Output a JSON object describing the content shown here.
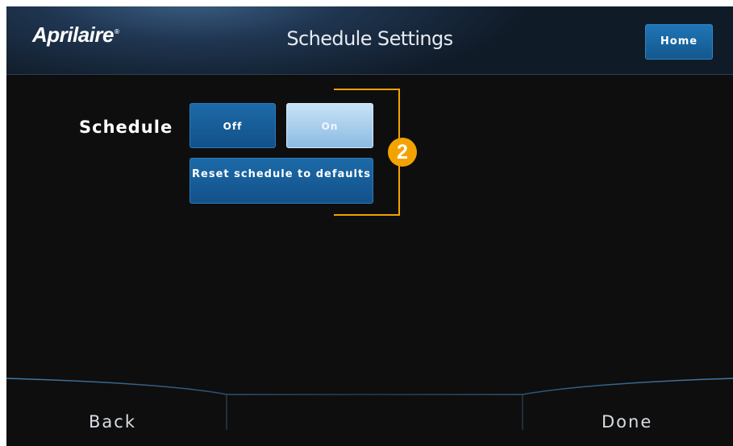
{
  "header": {
    "logo": "Aprilaire",
    "title": "Schedule Settings",
    "home_label": "Home"
  },
  "schedule": {
    "label": "Schedule",
    "off_label": "Off",
    "on_label": "On",
    "selected": "On",
    "reset_label": "Reset schedule to defaults"
  },
  "annotation": {
    "callout_number": "2",
    "color": "#f3a300"
  },
  "footer": {
    "back_label": "Back",
    "done_label": "Done"
  },
  "colors": {
    "button_blue": "#1c6aa8",
    "button_selected": "#a9d1ef",
    "background": "#0e0e0e"
  }
}
